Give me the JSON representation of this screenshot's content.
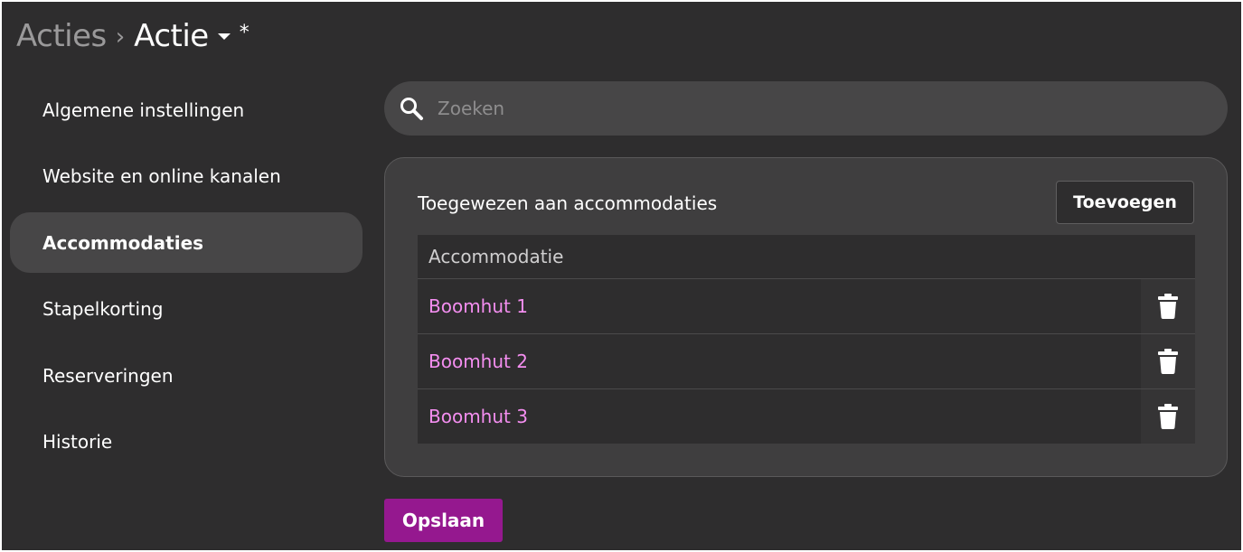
{
  "breadcrumb": {
    "parent": "Acties",
    "separator": "›",
    "current": "Actie",
    "dirty_marker": "*"
  },
  "sidebar": {
    "items": [
      {
        "label": "Algemene instellingen",
        "active": false
      },
      {
        "label": "Website en online kanalen",
        "active": false
      },
      {
        "label": "Accommodaties",
        "active": true
      },
      {
        "label": "Stapelkorting",
        "active": false
      },
      {
        "label": "Reserveringen",
        "active": false
      },
      {
        "label": "Historie",
        "active": false
      }
    ]
  },
  "search": {
    "placeholder": "Zoeken",
    "value": "",
    "icon": "search-icon"
  },
  "card": {
    "title": "Toegewezen aan accommodaties",
    "add_label": "Toevoegen",
    "table": {
      "column_header": "Accommodatie",
      "rows": [
        {
          "name": "Boomhut 1",
          "action_icon": "trash-icon"
        },
        {
          "name": "Boomhut 2",
          "action_icon": "trash-icon"
        },
        {
          "name": "Boomhut 3",
          "action_icon": "trash-icon"
        }
      ]
    }
  },
  "footer": {
    "save_label": "Opslaan"
  },
  "colors": {
    "background": "#2e2d2e",
    "panel": "#3f3e3f",
    "active_nav": "#474647",
    "link": "#f48ef0",
    "primary_button": "#95188f"
  }
}
